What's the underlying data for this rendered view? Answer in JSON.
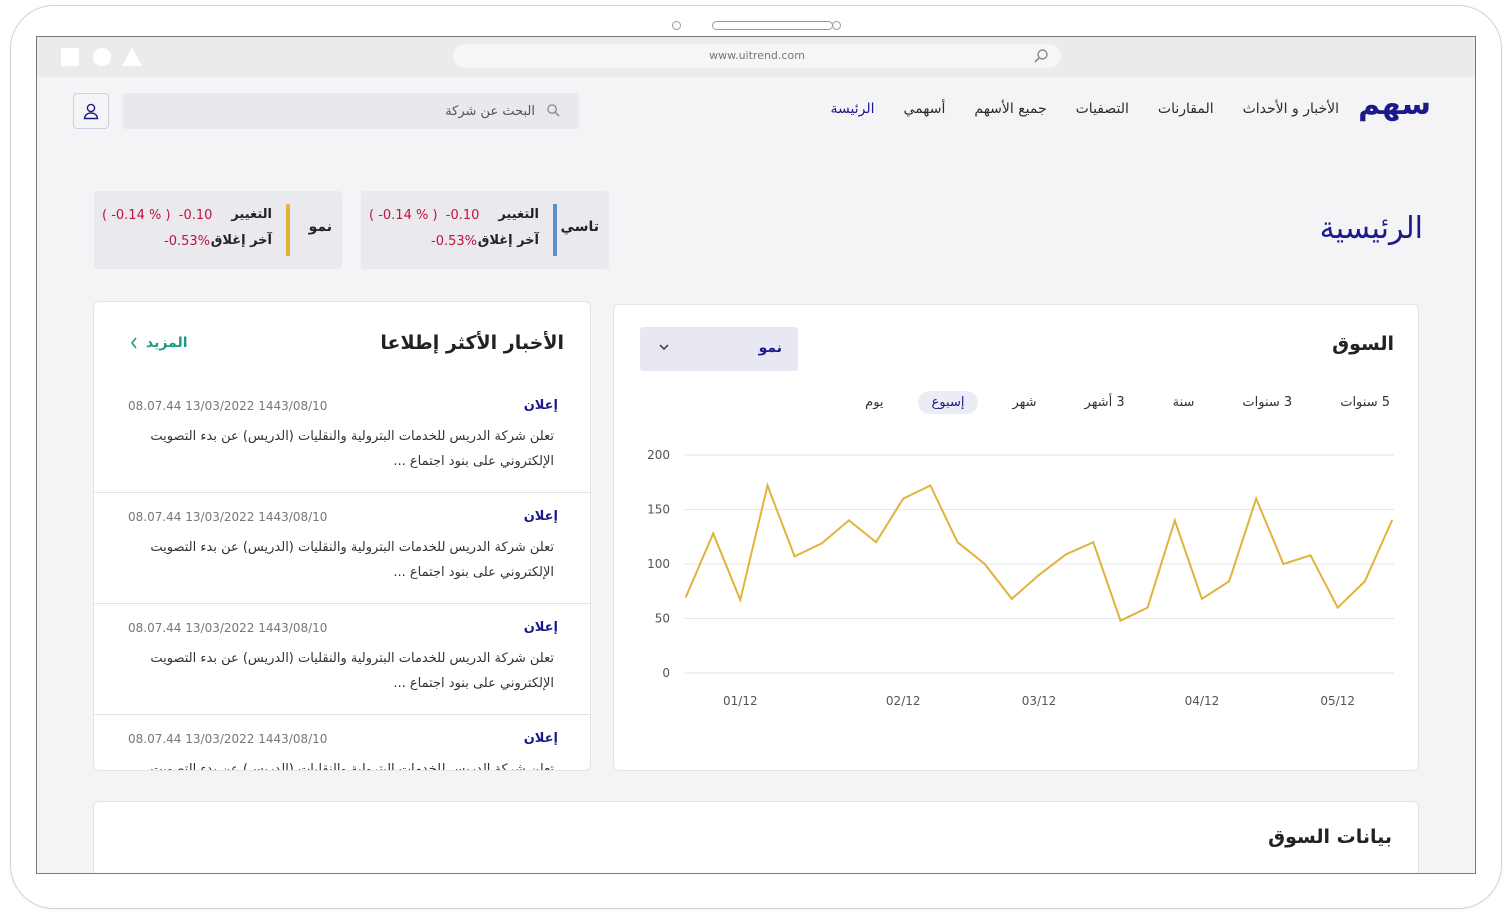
{
  "browser": {
    "url": "www.uitrend.com"
  },
  "header": {
    "logo": "سهم",
    "nav": [
      {
        "label": "الرئيسة",
        "active": true
      },
      {
        "label": "أسهمي"
      },
      {
        "label": "جميع الأسهم"
      },
      {
        "label": "التصفيات"
      },
      {
        "label": "المقارنات"
      },
      {
        "label": "الأخبار و الأحداث"
      }
    ],
    "search_placeholder": "البحث عن شركة"
  },
  "page_title": "الرئيسية",
  "tickers": [
    {
      "name": "تاسي",
      "change_label": "التغيير",
      "change_value": "-0.10",
      "change_pct": "( -0.14 % )",
      "close_label": "آخر إغلاق",
      "close_value": "-0.53%",
      "accent": "#5b8fd1"
    },
    {
      "name": "نمو",
      "change_label": "التغيير",
      "change_value": "-0.10",
      "change_pct": "( -0.14 % )",
      "close_label": "آخر إغلاق",
      "close_value": "-0.53%",
      "accent": "#e2b33c"
    }
  ],
  "market": {
    "title": "السوق",
    "dropdown_value": "نمو",
    "ranges": [
      {
        "label": "يوم"
      },
      {
        "label": "إسبوع",
        "active": true
      },
      {
        "label": "شهر"
      },
      {
        "label": "3 أشهر"
      },
      {
        "label": "سنة"
      },
      {
        "label": "3 سنوات"
      },
      {
        "label": "5 سنوات"
      }
    ]
  },
  "chart_data": {
    "type": "line",
    "title": "",
    "xlabel": "",
    "ylabel": "",
    "ylim": [
      0,
      200
    ],
    "yticks": [
      0,
      50,
      100,
      150,
      200
    ],
    "x_tick_labels": [
      "01/12",
      "02/12",
      "03/12",
      "04/12",
      "05/12"
    ],
    "x_tick_index": [
      2,
      8,
      13,
      19,
      24
    ],
    "values": [
      70,
      128,
      67,
      172,
      107,
      119,
      140,
      120,
      160,
      172,
      120,
      100,
      68,
      90,
      109,
      120,
      48,
      60,
      140,
      68,
      84,
      160,
      100,
      108,
      60,
      84,
      140
    ],
    "color": "#e2b33c",
    "grid": true
  },
  "news": {
    "title": "الأخبار الأكثر إطلاعا",
    "more_label": "المزيد",
    "items": [
      {
        "tag": "إعلان",
        "date": "08.07.44  13/03/2022  1443/08/10",
        "text": "تعلن شركة الدريس للخدمات البترولية والنقليات (الدريس) عن بدء التصويت الإلكتروني على بنود اجتماع ..."
      },
      {
        "tag": "إعلان",
        "date": "08.07.44  13/03/2022  1443/08/10",
        "text": "تعلن شركة الدريس للخدمات البترولية والنقليات (الدريس) عن بدء التصويت الإلكتروني على بنود اجتماع ..."
      },
      {
        "tag": "إعلان",
        "date": "08.07.44  13/03/2022  1443/08/10",
        "text": "تعلن شركة الدريس للخدمات البترولية والنقليات (الدريس) عن بدء التصويت الإلكتروني على بنود اجتماع ..."
      },
      {
        "tag": "إعلان",
        "date": "08.07.44  13/03/2022  1443/08/10",
        "text": "تعلن شركة الدريس للخدمات البترولية والنقليات (الدريس) عن بدء التصويت الإلكتروني على بنود اجتماع ..."
      }
    ]
  },
  "market_data": {
    "title": "بيانات السوق"
  }
}
